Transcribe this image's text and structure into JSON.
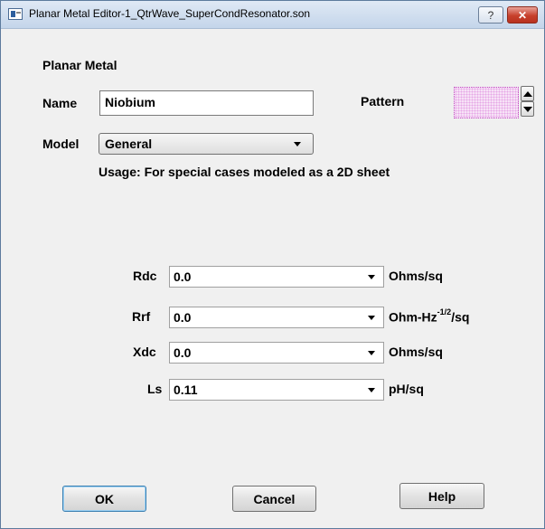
{
  "window": {
    "title": "Planar Metal Editor-1_QtrWave_SuperCondResonator.son",
    "help_glyph": "?",
    "close_glyph": "✕"
  },
  "section_title": "Planar Metal",
  "name": {
    "label": "Name",
    "value": "Niobium"
  },
  "pattern": {
    "label": "Pattern",
    "swatch_color": "#f7e2f7",
    "dot_color": "#e6a6e6"
  },
  "model": {
    "label": "Model",
    "value": "General",
    "usage": "Usage: For special cases modeled as a 2D sheet"
  },
  "params": {
    "rdc": {
      "label": "Rdc",
      "value": "0.0",
      "unit": "Ohms/sq"
    },
    "rrf": {
      "label": "Rrf",
      "value": "0.0",
      "unit_prefix": "Ohm-Hz",
      "unit_sup": "-1/2",
      "unit_suffix": "/sq"
    },
    "xdc": {
      "label": "Xdc",
      "value": "0.0",
      "unit": "Ohms/sq"
    },
    "ls": {
      "label": "Ls",
      "value": "0.11",
      "unit": "pH/sq"
    }
  },
  "buttons": {
    "ok": "OK",
    "cancel": "Cancel",
    "help": "Help"
  }
}
